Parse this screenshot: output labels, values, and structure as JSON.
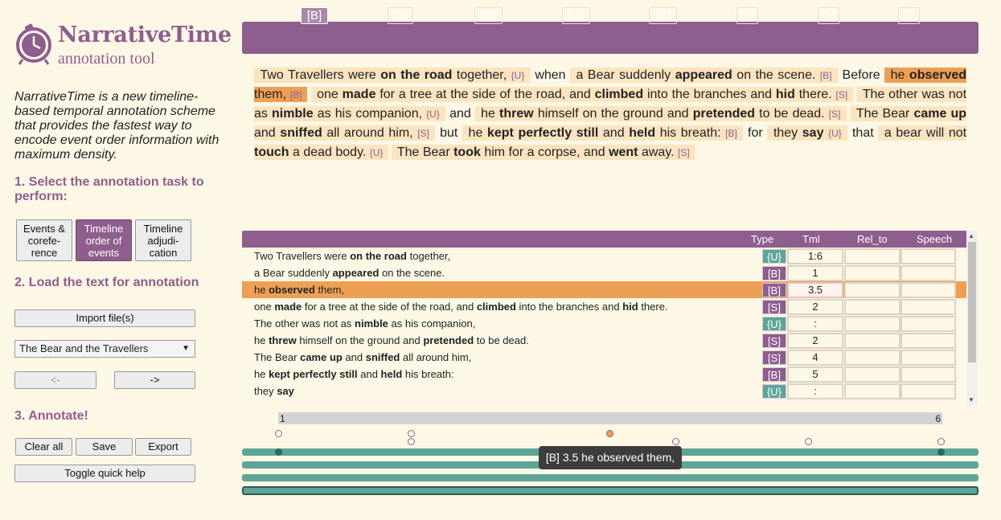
{
  "app": {
    "title": "NarrativeTime",
    "subtitle": "annotation tool",
    "intro_name": "NarrativeTime",
    "intro_rest": " is a new timeline-based temporal annotation scheme that provides the fastest way to encode event order information with maximum density."
  },
  "steps": {
    "select_task": "1. Select the annotation task to perform:",
    "load_text": "2. Load the text for annotation",
    "annotate": "3. Annotate!"
  },
  "tasks": [
    {
      "label": "Events & corefe-rence",
      "active": false
    },
    {
      "label": "Timeline order of events",
      "active": true
    },
    {
      "label": "Timeline adjudi-cation",
      "active": false
    }
  ],
  "load": {
    "import_label": "Import file(s)",
    "selected_text": "The Bear and the Travellers",
    "prev_label": "<-",
    "next_label": "->"
  },
  "annotate_buttons": {
    "clear_all": "Clear all",
    "save": "Save",
    "export": "Export",
    "toggle_help": "Toggle quick help"
  },
  "toolbar": [
    "[B]",
    "[S]",
    "{U}",
    "{U]",
    "[U}",
    "[<]",
    "[>]",
    "[I]"
  ],
  "story": {
    "s1": "Two Travellers were ",
    "s1b": "on the road",
    "s1c": " together, ",
    "t1": "{U}",
    "w1": " when ",
    "s2": "a Bear suddenly ",
    "s2b": "appeared",
    "s2c": " on the scene. ",
    "t2": "[B]",
    "w2": " Before ",
    "s3": "he ",
    "s3b": "observed",
    "s3c": " them, ",
    "t3": "[B]",
    "s4": "one ",
    "s4b": "made",
    "s4c": " for a tree at the side of the road, and ",
    "s4d": "climbed",
    "s4e": " into the branches and ",
    "s4f": "hid",
    "s4g": " there. ",
    "t4": "[S]",
    "s5": "The other was not as ",
    "s5b": "nimble",
    "s5c": " as his companion, ",
    "t5": "{U}",
    "w3": " and ",
    "s6": "he ",
    "s6b": "threw",
    "s6c": " himself on the ground and ",
    "s6d": "pretended",
    "s6e": " to be dead. ",
    "t6": "[S]",
    "s7": "The Bear ",
    "s7b": "came up",
    "s7c": " and ",
    "s7d": "sniffed",
    "s7e": " all around him, ",
    "t7": "[S]",
    "w4": " but ",
    "s8": "he ",
    "s8b": "kept perfectly still",
    "s8c": " and ",
    "s8d": "held",
    "s8e": " his breath: ",
    "t8": "[B]",
    "w5": " for ",
    "s9": "they ",
    "s9b": "say",
    "t9": "{U}",
    "w6": " that ",
    "s10": "a bear will not ",
    "s10b": "touch",
    "s10c": " a dead body. ",
    "t10": "{U}",
    "s11": "The Bear ",
    "s11b": "took",
    "s11c": " him for a corpse, and ",
    "s11d": "went",
    "s11e": " away. ",
    "t11": "[S]"
  },
  "table": {
    "headers": {
      "type": "Type",
      "tml": "Tml",
      "rel_to": "Rel_to",
      "speech": "Speech"
    },
    "rows": [
      {
        "a": "Two Travellers were ",
        "b": "on the road",
        "c": " together,",
        "type": "{U}",
        "tml": "1:6"
      },
      {
        "a": "a Bear suddenly ",
        "b": "appeared",
        "c": " on the scene.",
        "type": "[B]",
        "tml": "1"
      },
      {
        "a": "he ",
        "b": "observed",
        "c": " them,",
        "type": "[B]",
        "tml": "3.5"
      },
      {
        "a": "one ",
        "b": "made",
        "c": " for a tree at the side of the road, and ",
        "d": "climbed",
        "e": " into the branches and ",
        "f": "hid",
        "g": " there.",
        "type": "[S]",
        "tml": "2"
      },
      {
        "a": "The other was not as ",
        "b": "nimble",
        "c": " as his companion,",
        "type": "{U}",
        "tml": ":"
      },
      {
        "a": "he ",
        "b": "threw",
        "c": " himself on the ground and ",
        "d": "pretended",
        "e": " to be dead.",
        "type": "[S]",
        "tml": "2"
      },
      {
        "a": "The Bear ",
        "b": "came up",
        "c": " and ",
        "d": "sniffed",
        "e": " all around him,",
        "type": "[S]",
        "tml": "4"
      },
      {
        "a": "he ",
        "b": "kept perfectly still",
        "c": " and ",
        "d": "held",
        "e": " his breath:",
        "type": "[B]",
        "tml": "5"
      },
      {
        "a": "they ",
        "b": "say",
        "c": "",
        "type": "{U}",
        "tml": ":"
      }
    ]
  },
  "timeline": {
    "start_label": "1",
    "end_label": "6",
    "tooltip": "[B] 3.5 he observed them,"
  },
  "colors": {
    "accent": "#8e5e8e",
    "selected": "#eda055",
    "span": "#fbe4c0",
    "track": "#5ea597",
    "background": "#fdf8e6"
  },
  "icons": {
    "logo": "clock-icon"
  }
}
